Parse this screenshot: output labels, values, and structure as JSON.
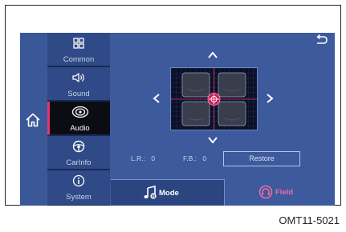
{
  "menu": {
    "items": [
      {
        "label": "Common",
        "icon": "grid-icon"
      },
      {
        "label": "Sound",
        "icon": "speaker-icon"
      },
      {
        "label": "Audio",
        "icon": "audio-rings-icon"
      },
      {
        "label": "CarInfo",
        "icon": "steering-wheel-icon"
      },
      {
        "label": "System",
        "icon": "info-icon"
      }
    ],
    "active": "Audio"
  },
  "readout": {
    "lr_label": "L.R.:",
    "lr_value": "0",
    "fb_label": "F.B.:",
    "fb_value": "0"
  },
  "buttons": {
    "restore": "Restore"
  },
  "tabs": {
    "mode": "Mode",
    "field": "Field"
  },
  "caption": "OMT11-5021",
  "colors": {
    "accent_pink": "#e6346e",
    "field_pink": "#f06ba6",
    "screen_blue": "#3c5a9c",
    "menu_dark": "#182a57"
  }
}
